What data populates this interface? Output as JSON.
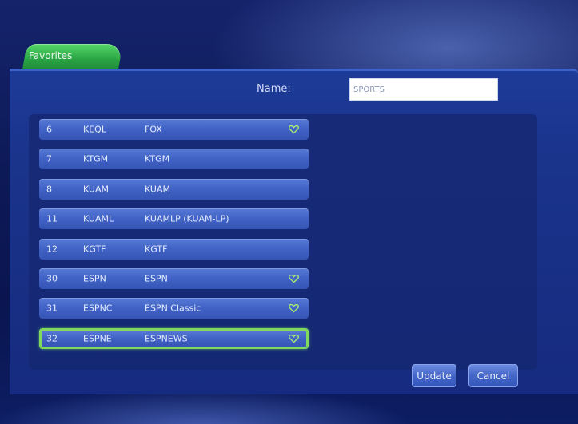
{
  "tab": {
    "label": "Favorites"
  },
  "name_field": {
    "label": "Name:",
    "value": "SPORTS"
  },
  "channels": [
    {
      "number": "6",
      "callsign": "KEQL",
      "name": "FOX",
      "favorite": true,
      "selected": false
    },
    {
      "number": "7",
      "callsign": "KTGM",
      "name": "KTGM",
      "favorite": false,
      "selected": false
    },
    {
      "number": "8",
      "callsign": "KUAM",
      "name": "KUAM",
      "favorite": false,
      "selected": false
    },
    {
      "number": "11",
      "callsign": "KUAML",
      "name": "KUAMLP (KUAM-LP)",
      "favorite": false,
      "selected": false
    },
    {
      "number": "12",
      "callsign": "KGTF",
      "name": "KGTF",
      "favorite": false,
      "selected": false
    },
    {
      "number": "30",
      "callsign": "ESPN",
      "name": "ESPN",
      "favorite": true,
      "selected": false
    },
    {
      "number": "31",
      "callsign": "ESPNC",
      "name": "ESPN Classic",
      "favorite": true,
      "selected": false
    },
    {
      "number": "32",
      "callsign": "ESPNE",
      "name": "ESPNEWS",
      "favorite": true,
      "selected": true
    }
  ],
  "buttons": {
    "update": "Update",
    "cancel": "Cancel"
  },
  "icons": {
    "favorite": "heart-icon"
  },
  "colors": {
    "accent": "#7ed95c",
    "panel": "#1a338b",
    "row": "#4264c6"
  }
}
